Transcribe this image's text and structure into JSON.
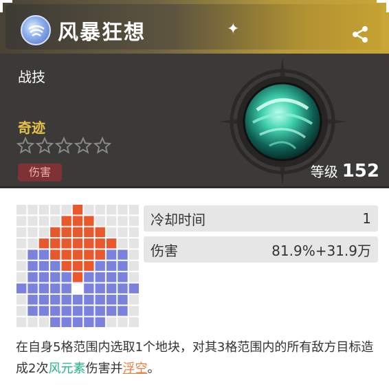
{
  "skill": {
    "name": "风暴狂想",
    "type": "战技",
    "rarity_label": "奇迹",
    "stars_total": 5,
    "stars_filled": 0,
    "tag": "伤害",
    "level_label": "等级",
    "level_value": "152",
    "element_icon": "wind-element-icon",
    "skill_icon": "whirlwind-skill-icon"
  },
  "stats": [
    {
      "label": "冷却时间",
      "value": "1"
    },
    {
      "label": "伤害",
      "value": "81.9%+31.9万"
    }
  ],
  "description": {
    "part1": "在自身5格范围内选取1个地块，对其3格范围内的所有敌方目标造成2次",
    "element_text": "风元素",
    "part2": "伤害并",
    "status_text": "浮空",
    "part3": "。"
  },
  "range_grid": {
    "size": 11,
    "legend": {
      "select": "#e8582c",
      "area": "#7b82de",
      "center": "#ffffff",
      "empty": "#e4e4e4"
    },
    "rows": [
      "00000100000",
      "00001110000",
      "00011111000",
      "00111111100",
      "02211111220",
      "02221112220",
      "02222122220",
      "22222322222",
      "02222222220",
      "02222222220",
      "00022222000"
    ]
  },
  "colors": {
    "gold": "#c6a232",
    "rarity": "#e7c045",
    "damage_badge": "#7e3234",
    "wind": "#23b585",
    "status": "#ed7d3e"
  }
}
